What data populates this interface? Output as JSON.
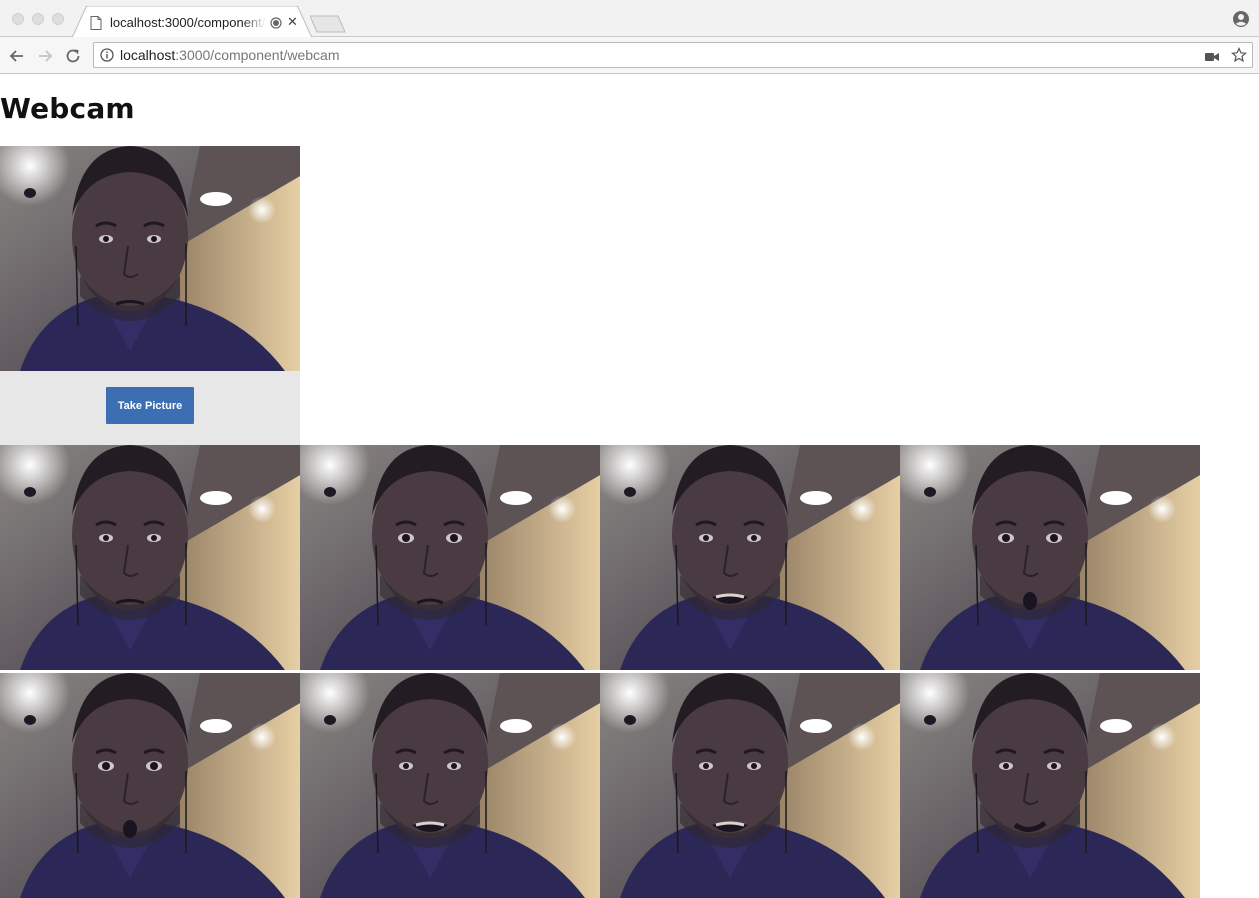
{
  "browser": {
    "tab_title": "localhost:3000/component/webcam",
    "url_host": "localhost",
    "url_path": ":3000/component/webcam"
  },
  "page": {
    "title": "Webcam",
    "take_picture_label": "Take Picture"
  },
  "gallery": {
    "shots": [
      {
        "expression": "neutral"
      },
      {
        "expression": "surprised"
      },
      {
        "expression": "grimace"
      },
      {
        "expression": "oh"
      },
      {
        "expression": "oh"
      },
      {
        "expression": "grimace"
      },
      {
        "expression": "grimace"
      },
      {
        "expression": "talking"
      }
    ]
  },
  "colors": {
    "button": "#3c6eb4",
    "webcam_panel": "#e7e7e7"
  }
}
